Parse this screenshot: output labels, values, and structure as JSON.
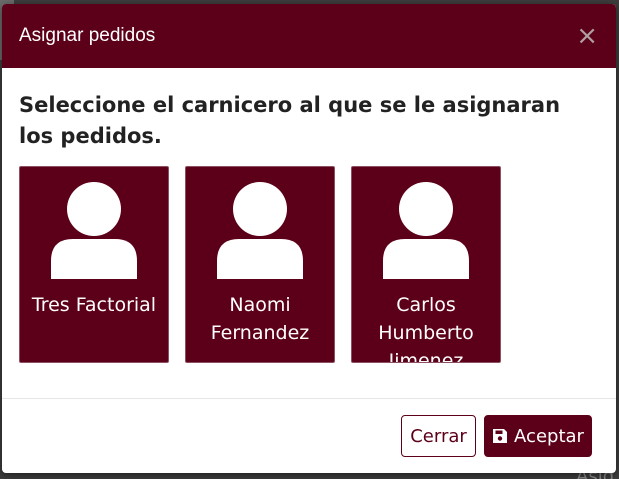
{
  "modal": {
    "title": "Asignar pedidos",
    "close_icon": "×",
    "prompt": "Seleccione el carnicero al que se le asignaran los pedidos.",
    "butchers": [
      {
        "name": "Tres Factorial",
        "icon": "user-icon"
      },
      {
        "name": "Naomi Fernandez",
        "icon": "user-icon"
      },
      {
        "name": "Carlos Humberto Jimenez",
        "icon": "user-icon"
      }
    ],
    "buttons": {
      "close_label": "Cerrar",
      "accept_label": "Aceptar",
      "accept_icon": "save-icon"
    }
  },
  "colors": {
    "brand": "#5c0019",
    "backdrop": "#3d3d3d"
  },
  "background": {
    "peek_text": "Asig"
  }
}
